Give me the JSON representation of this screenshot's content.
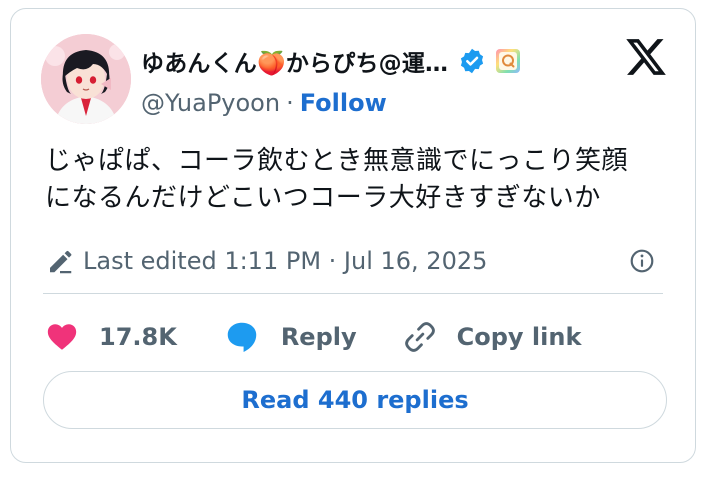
{
  "author": {
    "display_name": "ゆあんくん🍑からぴち@運…",
    "handle": "@YuaPyoon",
    "follow_label": "Follow"
  },
  "tweet": {
    "text_line1": "じゃぱぱ、コーラ飲むとき無意識でにっこり笑顔",
    "text_line2": "になるんだけどこいつコーラ大好きすぎないか",
    "edited_label": "Last edited 1:11 PM · Jul 16, 2025"
  },
  "actions": {
    "like_count": "17.8K",
    "reply_label": "Reply",
    "copy_link_label": "Copy link"
  },
  "footer": {
    "read_replies_label": "Read 440 replies"
  },
  "colors": {
    "accent": "#1d6ecf",
    "heart": "#f0337a",
    "reply_bubble": "#1d9bf0",
    "verified": "#1d9bf0"
  }
}
